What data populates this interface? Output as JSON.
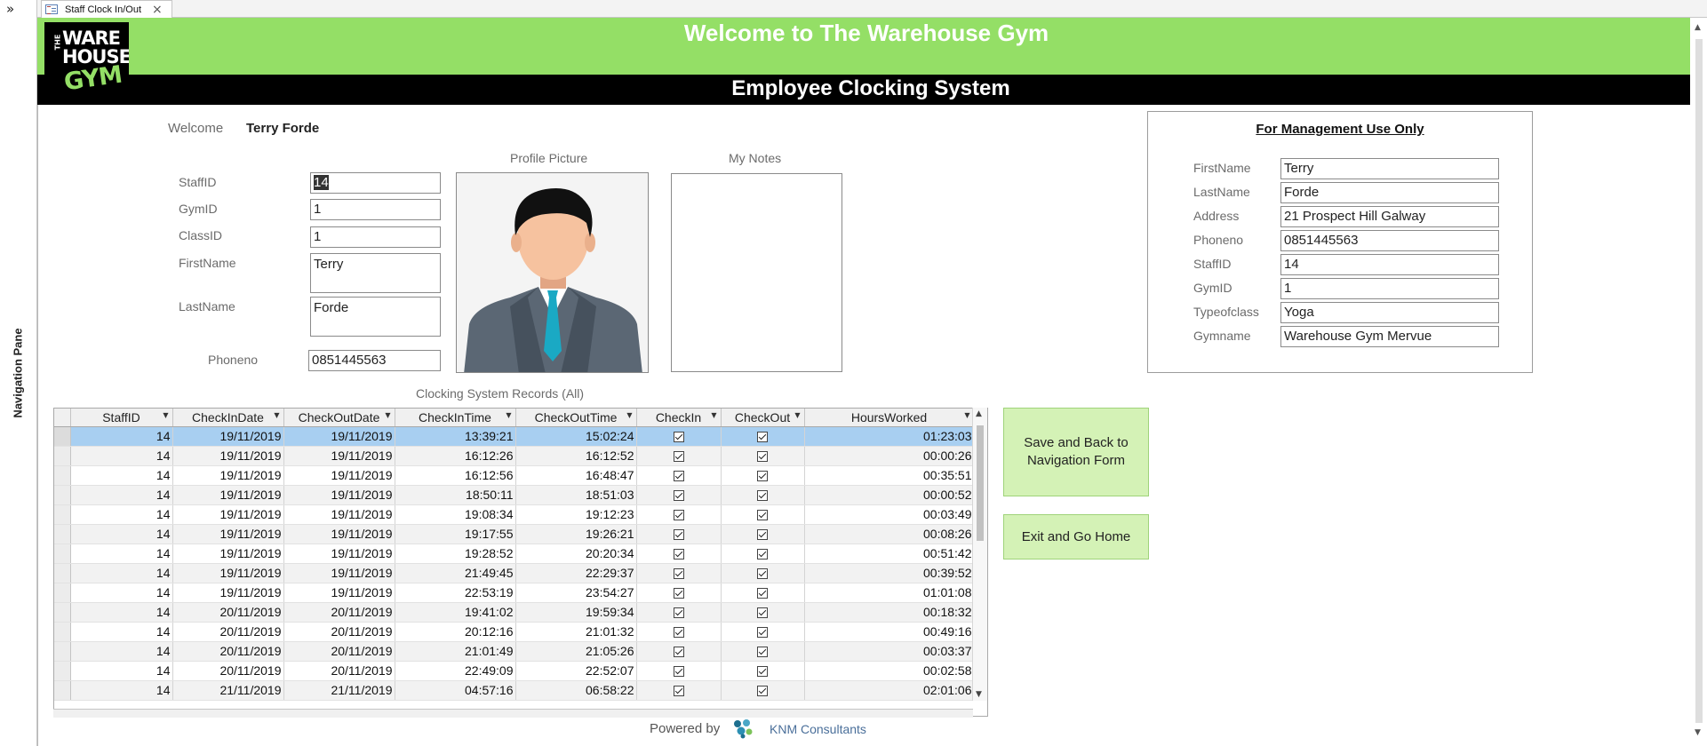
{
  "nav_pane": {
    "label": "Navigation Pane",
    "collapse_glyph": "»"
  },
  "tab": {
    "title": "Staff Clock In/Out",
    "close_glyph": "×"
  },
  "header": {
    "title": "Welcome to The Warehouse Gym",
    "subtitle": "Employee Clocking System",
    "logo": {
      "line1": "WARE",
      "line2": "HOUSE",
      "line3": "GYM",
      "prefix": "THE"
    }
  },
  "colors": {
    "header_green": "#94df66",
    "header_bar": "#000000",
    "button_fill": "#d4f2b6",
    "selected_row": "#a8cff1"
  },
  "welcome": {
    "label": "Welcome",
    "name": "Terry Forde"
  },
  "staff_form": {
    "staffid_label": "StaffID",
    "staffid": "14",
    "gymid_label": "GymID",
    "gymid": "1",
    "classid_label": "ClassID",
    "classid": "1",
    "firstname_label": "FirstName",
    "firstname": "Terry",
    "lastname_label": "LastName",
    "lastname": "Forde",
    "phoneno_label": "Phoneno",
    "phoneno": "0851445563"
  },
  "profile_picture": {
    "label": "Profile Picture"
  },
  "my_notes": {
    "label": "My Notes",
    "value": ""
  },
  "management": {
    "title": "For Management Use Only",
    "fields": [
      {
        "label": "FirstName",
        "value": "Terry"
      },
      {
        "label": "LastName",
        "value": "Forde"
      },
      {
        "label": "Address",
        "value": "21 Prospect Hill Galway"
      },
      {
        "label": "Phoneno",
        "value": "0851445563"
      },
      {
        "label": "StaffID",
        "value": "14"
      },
      {
        "label": "GymID",
        "value": "1"
      },
      {
        "label": "Typeofclass",
        "value": "Yoga"
      },
      {
        "label": "Gymname",
        "value": "Warehouse Gym Mervue"
      }
    ]
  },
  "records": {
    "title": "Clocking System Records (All)",
    "columns": [
      "StaffID",
      "CheckInDate",
      "CheckOutDate",
      "CheckInTime",
      "CheckOutTime",
      "CheckIn",
      "CheckOut",
      "HoursWorked"
    ],
    "rows": [
      [
        "14",
        "19/11/2019",
        "19/11/2019",
        "13:39:21",
        "15:02:24",
        true,
        true,
        "01:23:03"
      ],
      [
        "14",
        "19/11/2019",
        "19/11/2019",
        "16:12:26",
        "16:12:52",
        true,
        true,
        "00:00:26"
      ],
      [
        "14",
        "19/11/2019",
        "19/11/2019",
        "16:12:56",
        "16:48:47",
        true,
        true,
        "00:35:51"
      ],
      [
        "14",
        "19/11/2019",
        "19/11/2019",
        "18:50:11",
        "18:51:03",
        true,
        true,
        "00:00:52"
      ],
      [
        "14",
        "19/11/2019",
        "19/11/2019",
        "19:08:34",
        "19:12:23",
        true,
        true,
        "00:03:49"
      ],
      [
        "14",
        "19/11/2019",
        "19/11/2019",
        "19:17:55",
        "19:26:21",
        true,
        true,
        "00:08:26"
      ],
      [
        "14",
        "19/11/2019",
        "19/11/2019",
        "19:28:52",
        "20:20:34",
        true,
        true,
        "00:51:42"
      ],
      [
        "14",
        "19/11/2019",
        "19/11/2019",
        "21:49:45",
        "22:29:37",
        true,
        true,
        "00:39:52"
      ],
      [
        "14",
        "19/11/2019",
        "19/11/2019",
        "22:53:19",
        "23:54:27",
        true,
        true,
        "01:01:08"
      ],
      [
        "14",
        "20/11/2019",
        "20/11/2019",
        "19:41:02",
        "19:59:34",
        true,
        true,
        "00:18:32"
      ],
      [
        "14",
        "20/11/2019",
        "20/11/2019",
        "20:12:16",
        "21:01:32",
        true,
        true,
        "00:49:16"
      ],
      [
        "14",
        "20/11/2019",
        "20/11/2019",
        "21:01:49",
        "21:05:26",
        true,
        true,
        "00:03:37"
      ],
      [
        "14",
        "20/11/2019",
        "20/11/2019",
        "22:49:09",
        "22:52:07",
        true,
        true,
        "00:02:58"
      ],
      [
        "14",
        "21/11/2019",
        "21/11/2019",
        "04:57:16",
        "06:58:22",
        true,
        true,
        "02:01:06"
      ]
    ]
  },
  "buttons": {
    "save_back_line1": "Save and Back to",
    "save_back_line2": "Navigation Form",
    "exit_home": "Exit and Go Home"
  },
  "footer": {
    "powered_by": "Powered by",
    "company": "KNM Consultants"
  }
}
